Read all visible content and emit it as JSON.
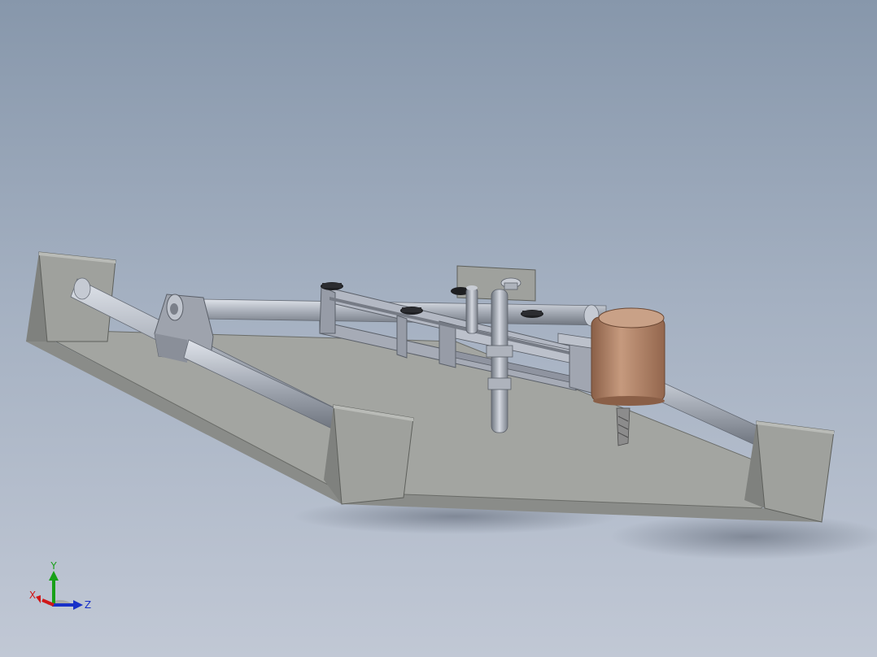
{
  "viewport": {
    "background_top": "#8797ab",
    "background_bottom": "#c1c8d5"
  },
  "model": {
    "base_color": "#a4a6a2",
    "block_color": "#9a9c98",
    "rod_color": "#b4bac4",
    "carriage_color": "#a9aebb",
    "spindle_color": "#b88a6e",
    "bit_color": "#8c8c8c"
  },
  "triad": {
    "x_label": "X",
    "y_label": "Y",
    "z_label": "Z",
    "x_color": "#d01818",
    "y_color": "#18a018",
    "z_color": "#1830c8"
  }
}
